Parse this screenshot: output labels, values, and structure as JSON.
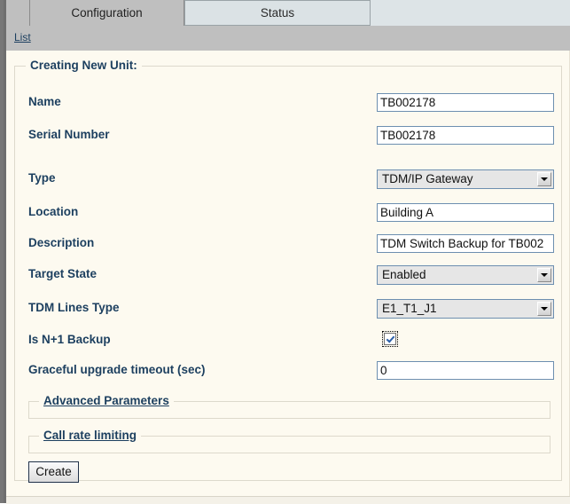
{
  "tabs": [
    {
      "label": "Configuration",
      "active": true
    },
    {
      "label": "Status",
      "active": false
    }
  ],
  "toolbar": {
    "list_link": "List"
  },
  "form": {
    "legend": "Creating New Unit:",
    "fields": {
      "name": {
        "label": "Name",
        "value": "TB002178"
      },
      "serial_number": {
        "label": "Serial Number",
        "value": "TB002178"
      },
      "type": {
        "label": "Type",
        "value": "TDM/IP Gateway"
      },
      "location": {
        "label": "Location",
        "value": "Building A"
      },
      "description": {
        "label": "Description",
        "value": "TDM Switch Backup for TB002"
      },
      "target_state": {
        "label": "Target State",
        "value": "Enabled"
      },
      "tdm_lines_type": {
        "label": "TDM Lines Type",
        "value": "E1_T1_J1"
      },
      "is_n1_backup": {
        "label": "Is N+1 Backup",
        "checked": true
      },
      "graceful_upgrade_timeout": {
        "label": "Graceful upgrade timeout (sec)",
        "value": "0"
      }
    },
    "sections": [
      {
        "label": "Advanced Parameters"
      },
      {
        "label": "Call rate limiting"
      }
    ],
    "submit_label": "Create"
  },
  "colors": {
    "chrome": "#bfbfbf",
    "sheet": "#fdfaf0",
    "label": "#1c3f5f",
    "input_border": "#6d8fb0",
    "tab_inactive": "#dbe2e5"
  }
}
